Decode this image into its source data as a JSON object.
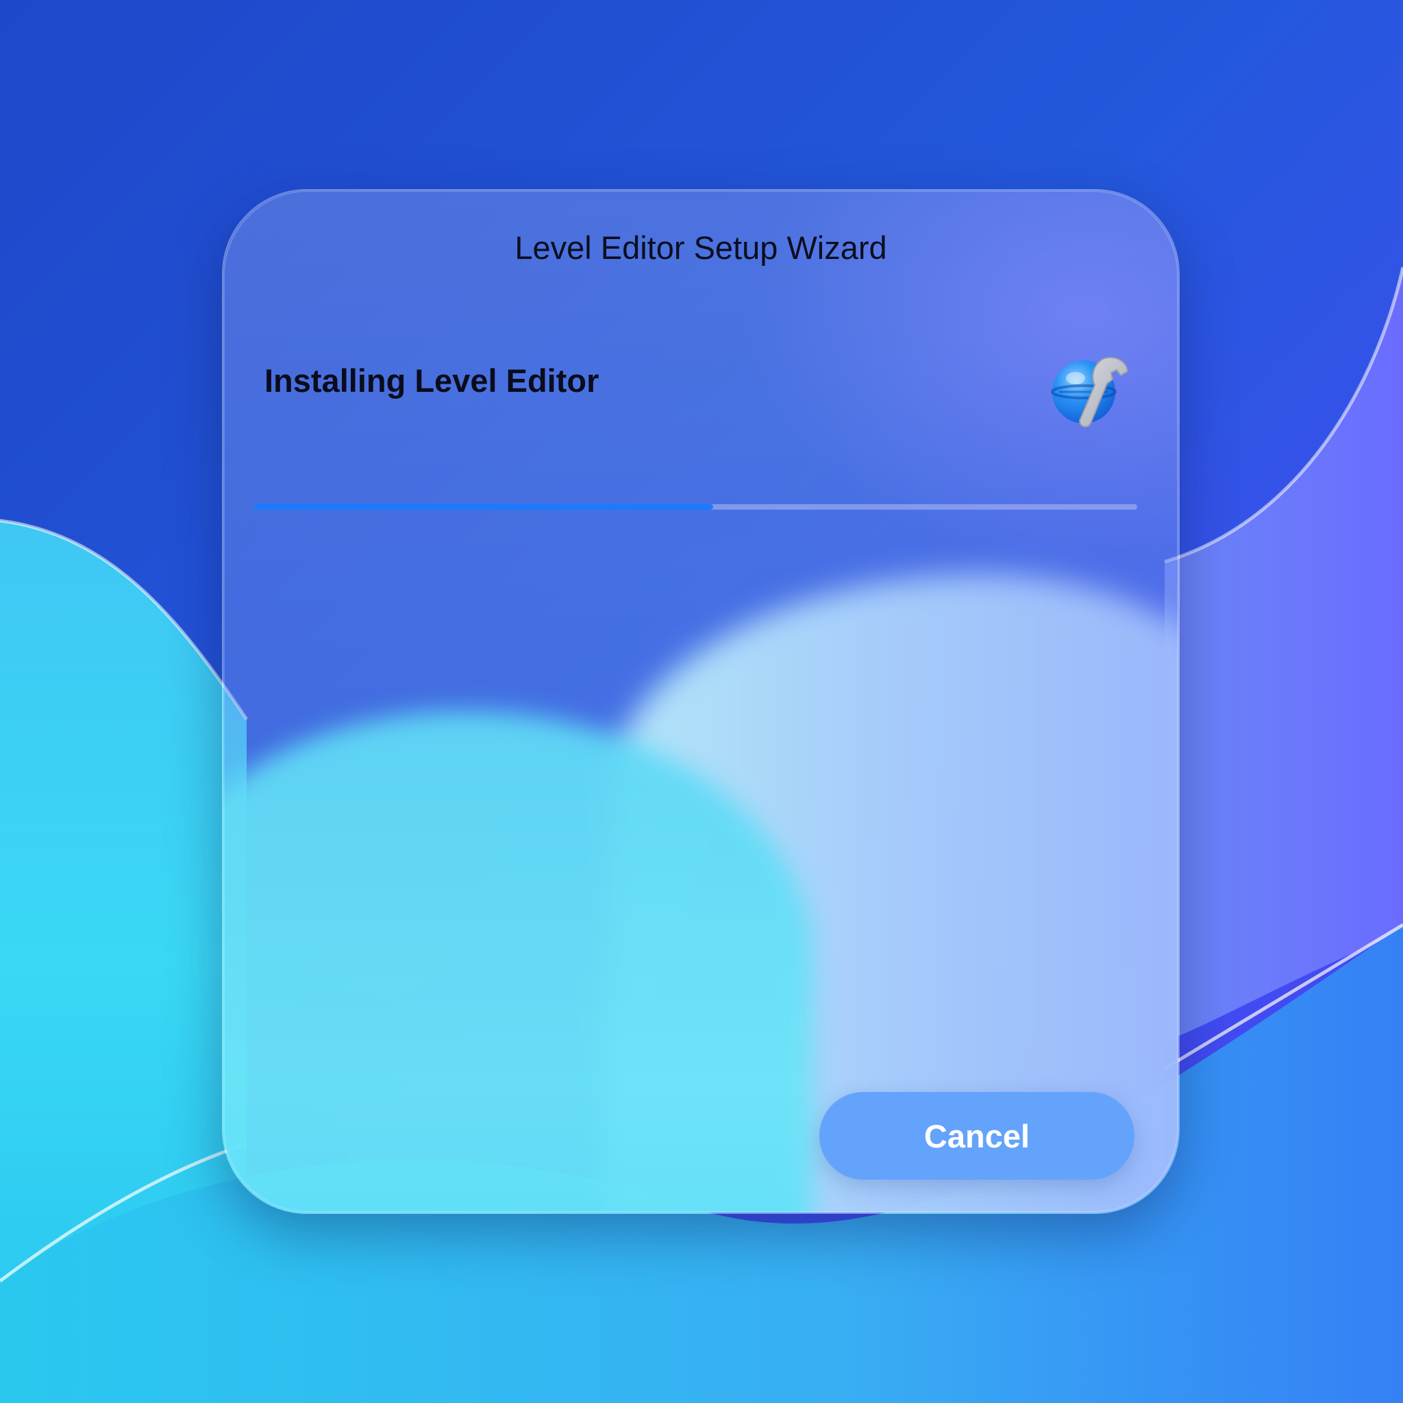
{
  "window": {
    "title": "Level Editor Setup Wizard"
  },
  "installer": {
    "heading": "Installing Level Editor",
    "icon": "globe-wrench-icon",
    "progress_fraction": 0.52
  },
  "actions": {
    "cancel_label": "Cancel"
  },
  "colors": {
    "accent": "#1a7bff",
    "button": "#64a3fb",
    "wallpaper_dark": "#1f47c9",
    "wallpaper_cyan": "#33d0f3"
  }
}
